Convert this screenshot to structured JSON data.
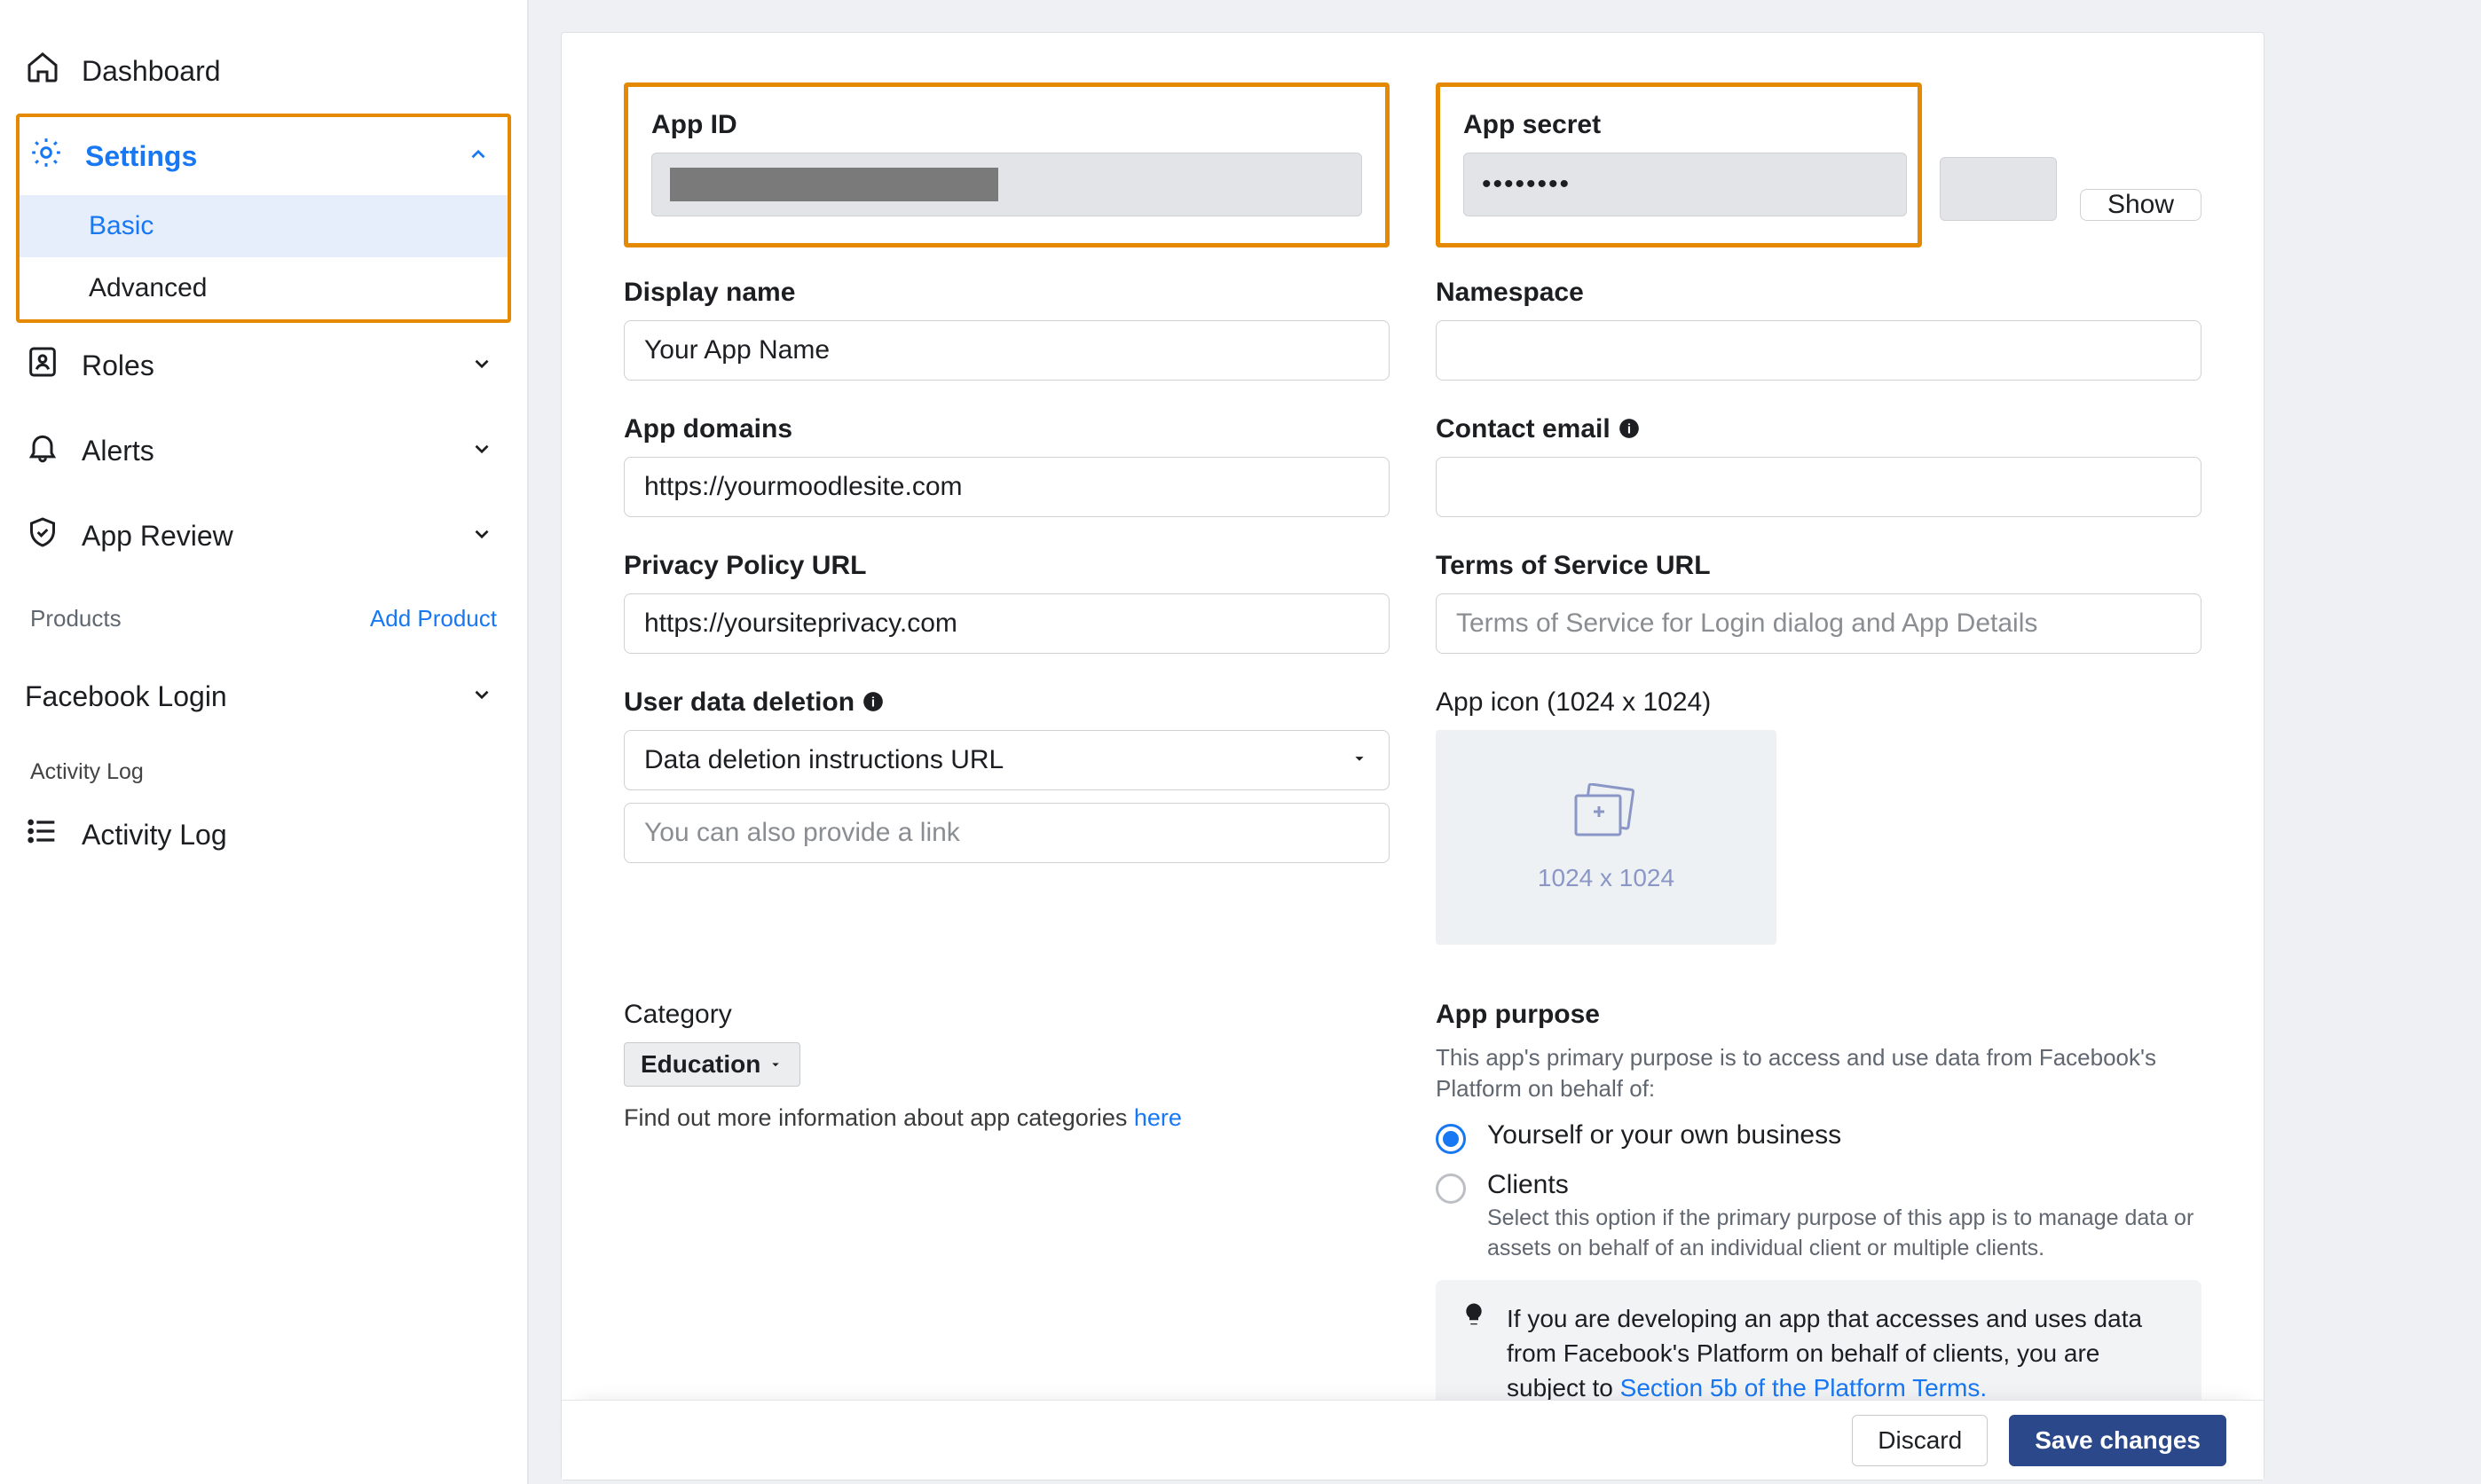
{
  "sidebar": {
    "dashboard": "Dashboard",
    "settings": "Settings",
    "settings_items": {
      "basic": "Basic",
      "advanced": "Advanced"
    },
    "roles": "Roles",
    "alerts": "Alerts",
    "app_review": "App Review",
    "products": "Products",
    "add_product": "Add Product",
    "facebook_login": "Facebook Login",
    "activity_log_heading": "Activity Log",
    "activity_log": "Activity Log"
  },
  "fields": {
    "app_id": {
      "label": "App ID"
    },
    "app_secret": {
      "label": "App secret",
      "value_masked": "••••••••",
      "show": "Show"
    },
    "display_name": {
      "label": "Display name",
      "value": "Your App Name"
    },
    "namespace": {
      "label": "Namespace"
    },
    "app_domains": {
      "label": "App domains",
      "value": "https://yourmoodlesite.com"
    },
    "contact_email": {
      "label": "Contact email"
    },
    "privacy_url": {
      "label": "Privacy Policy URL",
      "value": "https://yoursiteprivacy.com"
    },
    "tos_url": {
      "label": "Terms of Service URL",
      "placeholder": "Terms of Service for Login dialog and App Details"
    },
    "user_data_deletion": {
      "label": "User data deletion",
      "select_value": "Data deletion instructions URL",
      "link_placeholder": "You can also provide a link"
    },
    "app_icon": {
      "label": "App icon (1024 x 1024)",
      "hint": "1024 x 1024"
    },
    "category": {
      "label": "Category",
      "value": "Education",
      "help_pre": "Find out more information about app categories ",
      "help_link": "here"
    },
    "app_purpose": {
      "label": "App purpose",
      "desc": "This app's primary purpose is to access and use data from Facebook's Platform on behalf of:",
      "opt_self": "Yourself or your own business",
      "opt_clients": "Clients",
      "opt_clients_desc": "Select this option if the primary purpose of this app is to manage data or assets on behalf of an individual client or multiple clients.",
      "banner_pre": "If you are developing an app that accesses and uses data from Facebook's Platform on behalf of clients, you are subject to ",
      "banner_link": "Section 5b of the Platform Terms."
    }
  },
  "footer": {
    "discard": "Discard",
    "save": "Save changes"
  }
}
